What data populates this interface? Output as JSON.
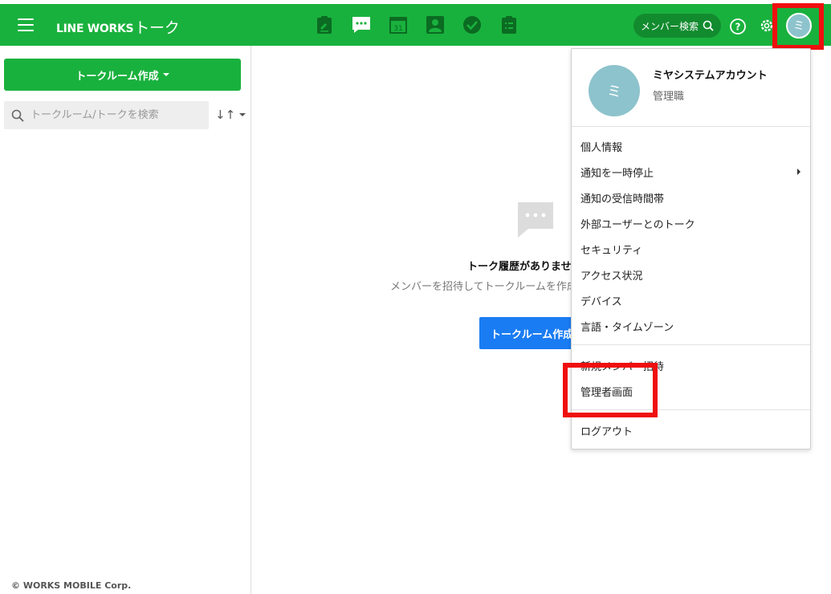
{
  "header": {
    "brand": "LINE WORKS",
    "app_name": "トーク",
    "member_search_label": "メンバー検索",
    "nav_icons": [
      "board-icon",
      "talk-icon",
      "calendar-icon",
      "contacts-icon",
      "task-icon",
      "survey-icon"
    ],
    "calendar_day": "31",
    "avatar_initial": "ミ",
    "accent_color": "#19b13d"
  },
  "sidebar": {
    "create_button_label": "トークルーム作成",
    "search_placeholder": "トークルーム/トークを検索",
    "sort_label": "↓↑",
    "copyright": "© WORKS MOBILE Corp."
  },
  "main": {
    "empty_title": "トーク履歴がありません",
    "empty_description": "メンバーを招待してトークルームを作成しましょう",
    "empty_button_label": "トークルーム作成"
  },
  "menu": {
    "user_name": "ミヤシステムアカウント",
    "user_role": "管理職",
    "avatar_initial": "ミ",
    "group1": [
      "個人情報",
      "通知を一時停止",
      "通知の受信時間帯",
      "外部ユーザーとのトーク",
      "セキュリティ",
      "アクセス状況",
      "デバイス",
      "言語・タイムゾーン"
    ],
    "group2": [
      "新規メンバー招待",
      "管理者画面"
    ],
    "group3": [
      "ログアウト"
    ]
  }
}
